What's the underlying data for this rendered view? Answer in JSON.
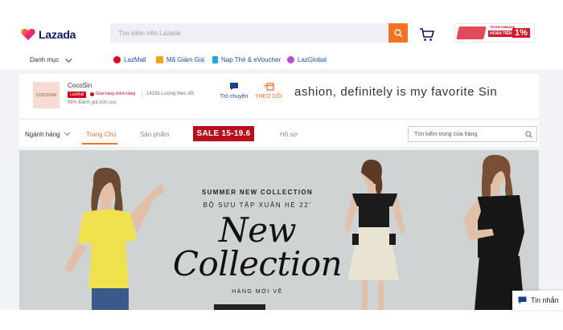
{
  "header": {
    "logo_text": "Lazada",
    "search_placeholder": "Tìm kiếm trên Lazada",
    "promo": {
      "bank": "TECHCOMBANK",
      "line": "HOÀN TIỀN",
      "percent": "1%"
    }
  },
  "nav": {
    "category_label": "Danh mục",
    "links": [
      "LazMall",
      "Mã Giảm Giá",
      "Nạp Thẻ & eVoucher",
      "LazGlobal"
    ]
  },
  "shop": {
    "logo_text": "COCOSIN",
    "name": "CocoSin",
    "lazmall_badge": "LazMall",
    "official_label": "Gian hàng chính hãng",
    "followers": "14335 Lượng theo dõi",
    "rating": "96% Đánh giá tích cực",
    "chat_label": "Trò chuyện",
    "follow_label": "THEO DÕI",
    "marquee": "ashion, definitely is my favorite Sin"
  },
  "tabs": {
    "items": [
      "Ngành hàng",
      "Trang Chủ",
      "Sản phẩm",
      "Hồ sơ"
    ],
    "active": "Trang Chủ",
    "sale_label": "SALE 15-19.6",
    "search_placeholder": "Tìm kiếm trong cửa hàng"
  },
  "banner": {
    "summer": "SUMMER NEW COLLECTION",
    "bst": "BỘ SƯU TẬP XUÂN HÈ 22'",
    "script_line1": "New",
    "script_line2": "Collection",
    "subtitle": "HÀNG MỚI VỀ"
  },
  "chat_float": {
    "label": "Tin nhắn"
  },
  "colors": {
    "accent": "#f57224",
    "brand_navy": "#0f146d",
    "link_blue": "#1a4db3",
    "sale_red": "#b8101f"
  }
}
